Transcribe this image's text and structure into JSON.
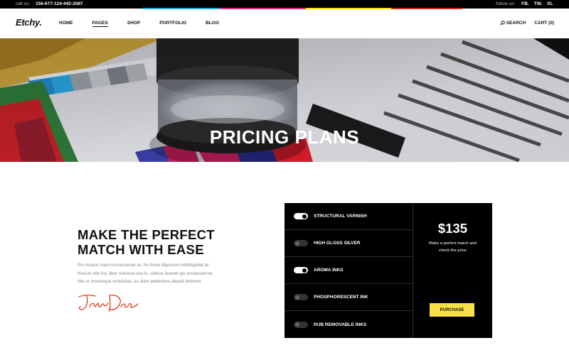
{
  "topbar": {
    "call_label": "call us:",
    "phone": "156-677-124-442-2087",
    "follow_label": "follow us:",
    "social": [
      "FB.",
      "TW.",
      "IG."
    ]
  },
  "nav": {
    "logo": "Etchy.",
    "menu": [
      "HOME",
      "PAGES",
      "SHOP",
      "PORTFOLIO",
      "BLOG"
    ],
    "active": "PAGES",
    "search_label": "SEARCH",
    "cart_label": "CART (0)"
  },
  "hero": {
    "title": "PRICING PLANS"
  },
  "content": {
    "headline_line1": "MAKE THE PERFECT",
    "headline_line2": "MATCH WITH EASE",
    "body_line1": "Pro modus mani consectetuer te, his brute dignissim intellegebat at.",
    "body_line2": "Novum elitr his, liber noluisse sea in, vidisse laoreet qui prodesset ne.",
    "body_line3": "Mei ut omnesque molestiae, eu diam petentium aliquid dolorem.",
    "signature": "JaneDoe"
  },
  "pricing": {
    "options": [
      {
        "label": "STRUCTURAL VARNISH",
        "enabled": true
      },
      {
        "label": "HIGH GLOSS SILVER",
        "enabled": false
      },
      {
        "label": "AROMA INKS",
        "enabled": true
      },
      {
        "label": "PHOSPHORESCENT INK",
        "enabled": false
      },
      {
        "label": "RUB REMOVABLE INKS",
        "enabled": false
      }
    ],
    "price": "$135",
    "desc_line1": "Make a perfect match and",
    "desc_line2": "check the price",
    "purchase_label": "PURCHASE"
  },
  "colors": {
    "accent_yellow": "#f8e047",
    "stripe_cyan": "#21a8e1",
    "stripe_magenta": "#e62a7b",
    "stripe_yellow": "#ffe100",
    "stripe_red": "#d9261c",
    "panel_bg": "#000000",
    "signature": "#e03a1e"
  }
}
